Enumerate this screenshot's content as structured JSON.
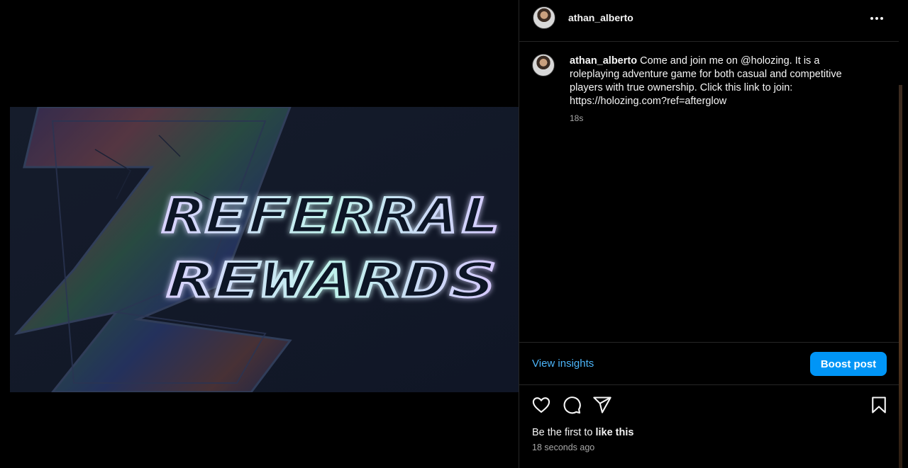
{
  "post": {
    "username": "athan_alberto",
    "image": {
      "title_line1": "REFERRAL",
      "title_line2": "REWARDS"
    },
    "caption": {
      "username": "athan_alberto",
      "text": "Come and join me on @holozing. It is a roleplaying adventure game for both casual and competitive players with true ownership. Click this link to join: https://holozing.com?ref=afterglow",
      "time": "18s"
    },
    "insights": {
      "view_label": "View insights",
      "boost_label": "Boost post"
    },
    "actions": {
      "icons": [
        "heart-icon",
        "comment-icon",
        "share-icon",
        "bookmark-icon"
      ]
    },
    "likes": {
      "prefix": "Be the first to",
      "link": "like this"
    },
    "timestamp": "18 seconds ago"
  },
  "colors": {
    "background": "#000000",
    "link_blue": "#4cb5f9",
    "button_blue": "#0095f6",
    "muted_text": "#a8a8a8"
  }
}
